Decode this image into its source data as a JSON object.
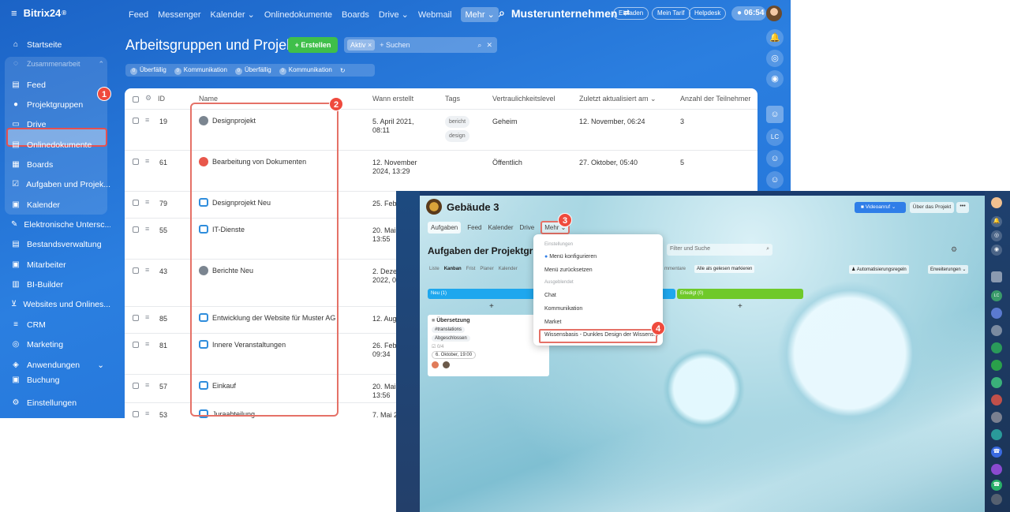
{
  "app": {
    "logo_text": "Bitrix24",
    "logo_suffix": "®"
  },
  "topnav": [
    "Feed",
    "Messenger",
    "Kalender ⌄",
    "Onlinedokumente",
    "Boards",
    "Drive ⌄",
    "Webmail",
    "Mehr ⌄"
  ],
  "company": "Musterunternehmen",
  "top_pills": {
    "invite": "Einladen",
    "plan": "Mein Tarif",
    "help": "Helpdesk"
  },
  "clock": "06:54",
  "sidebar": {
    "items": [
      {
        "label": "Startseite",
        "icon": "⌂"
      },
      {
        "label": "Zusammenarbeit",
        "icon": "◌"
      },
      {
        "label": "Feed",
        "icon": "▤"
      },
      {
        "label": "Projektgruppen",
        "icon": "👥"
      },
      {
        "label": "Drive",
        "icon": "▭"
      },
      {
        "label": "Onlinedokumente",
        "icon": "▤"
      },
      {
        "label": "Boards",
        "icon": "▦"
      },
      {
        "label": "Aufgaben und Projek...",
        "icon": "☑"
      },
      {
        "label": "Kalender",
        "icon": "▣"
      },
      {
        "label": "Elektronische Untersc...",
        "icon": "✎"
      },
      {
        "label": "Bestandsverwaltung",
        "icon": "▤"
      },
      {
        "label": "Mitarbeiter",
        "icon": "▣"
      },
      {
        "label": "BI-Builder",
        "icon": "▥"
      },
      {
        "label": "Websites und Onlines...",
        "icon": "🛒"
      },
      {
        "label": "CRM",
        "icon": "≡"
      },
      {
        "label": "Marketing",
        "icon": "◎"
      },
      {
        "label": "Anwendungen",
        "icon": "◈"
      },
      {
        "label": "Buchung",
        "icon": "▣"
      },
      {
        "label": "Einstellungen",
        "icon": "⚙"
      }
    ]
  },
  "markers": [
    "1",
    "2",
    "3",
    "4"
  ],
  "page": {
    "title": "Arbeitsgruppen und Projekte",
    "create_button": "+ Erstellen",
    "search_chip": "Aktiv ×",
    "search_placeholder": "+ Suchen"
  },
  "filters": [
    {
      "count": "0",
      "label": "Überfällig"
    },
    {
      "count": "0",
      "label": "Kommunikation"
    },
    {
      "count": "0",
      "label": "Überfällig"
    },
    {
      "count": "0",
      "label": "Kommunikation"
    }
  ],
  "table": {
    "headers": {
      "id": "ID",
      "name": "Name",
      "created": "Wann erstellt",
      "tags": "Tags",
      "privacy": "Vertraulichkeitslevel",
      "updated": "Zuletzt aktualisiert am ⌄",
      "members": "Anzahl der Teilnehmer"
    },
    "rows": [
      {
        "id": "19",
        "name": "Designprojekt",
        "created": "5. April 2021,",
        "created2": "08:11",
        "tag1": "bericht",
        "tag2": "design",
        "privacy": "Geheim",
        "updated": "12. November, 06:24",
        "members": "3",
        "icon": "round-grey"
      },
      {
        "id": "61",
        "name": "Bearbeitung von Dokumenten",
        "created": "12. November",
        "created2": "2024, 13:29",
        "tag1": "",
        "tag2": "",
        "privacy": "Öffentlich",
        "updated": "27. Oktober, 05:40",
        "members": "5",
        "icon": "round-red"
      },
      {
        "id": "79",
        "name": "Designprojekt Neu",
        "created": "25. Febr",
        "created2": "",
        "tag1": "",
        "tag2": "",
        "privacy": "",
        "updated": "",
        "members": "",
        "icon": "folder"
      },
      {
        "id": "55",
        "name": "IT-Dienste",
        "created": "20. Mai",
        "created2": "13:55",
        "tag1": "",
        "tag2": "",
        "privacy": "",
        "updated": "",
        "members": "",
        "icon": "folder"
      },
      {
        "id": "43",
        "name": "Berichte Neu",
        "created": "2. Deze",
        "created2": "2022, 0",
        "tag1": "",
        "tag2": "",
        "privacy": "",
        "updated": "",
        "members": "",
        "icon": "round-grey"
      },
      {
        "id": "85",
        "name": "Entwicklung der Website für Muster AG",
        "created": "12. Aug",
        "created2": "",
        "tag1": "",
        "tag2": "",
        "privacy": "",
        "updated": "",
        "members": "",
        "icon": "folder"
      },
      {
        "id": "81",
        "name": "Innere Veranstaltungen",
        "created": "26. Feb",
        "created2": "09:34",
        "tag1": "",
        "tag2": "",
        "privacy": "",
        "updated": "",
        "members": "",
        "icon": "folder"
      },
      {
        "id": "57",
        "name": "Einkauf",
        "created": "20. Mai",
        "created2": "13:56",
        "tag1": "",
        "tag2": "",
        "privacy": "",
        "updated": "",
        "members": "",
        "icon": "folder"
      },
      {
        "id": "53",
        "name": "Juraabteilung",
        "created": "7. Mai 2",
        "created2": "",
        "tag1": "",
        "tag2": "",
        "privacy": "",
        "updated": "",
        "members": "",
        "icon": "folder"
      }
    ]
  },
  "overlay": {
    "title": "Gebäude 3",
    "tabs": [
      "Aufgaben",
      "Feed",
      "Kalender",
      "Drive",
      "Mehr ⌄"
    ],
    "video_button": "Videoanruf",
    "about_button": "Über das Projekt",
    "more_button": "•••",
    "tasks_title": "Aufgaben der Projektgrupp",
    "filter_placeholder": "Filter und Suche",
    "subtabs": [
      "Liste",
      "Kanban",
      "Frist",
      "Planer",
      "Kalender"
    ],
    "comments_text": "mmentare",
    "mark_read": "Alle als gelesen markieren",
    "automation": "Automatisierungsregeln",
    "extensions": "Erweiterungen",
    "col_new": "Neu (1)",
    "col_done": "Erledigt (0)",
    "plus": "+",
    "card": {
      "title": "Übersetzung",
      "tag1": "#translations",
      "tag2": "Abgeschlossen",
      "count": "0/4",
      "date": "6. Oktober, 19:00"
    },
    "menu": {
      "section1": "Einstellungen",
      "item1": "Menü konfigurieren",
      "item2": "Menü zurücksetzen",
      "section2": "Ausgeblendet",
      "item3": "Chat",
      "item4": "Kommunikation",
      "item5": "Market",
      "item6": "Wissensbasis - Dunkles Design der Wissens..."
    }
  },
  "colors": {
    "accent": "#2b7fe0",
    "create_green": "#3fbf4a",
    "marker_red": "#ef4a3d",
    "col_new": "#1ea7ee",
    "col_done": "#6fc92a"
  }
}
